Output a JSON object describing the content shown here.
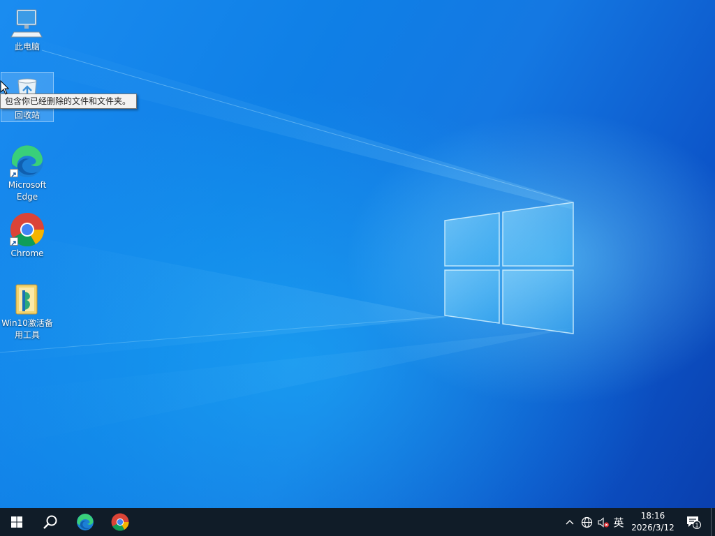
{
  "desktop": {
    "icons": [
      {
        "name": "this-pc",
        "label": "此电脑",
        "icon": "computer-icon"
      },
      {
        "name": "recycle-bin",
        "label": "回收站",
        "icon": "recycle-bin-icon",
        "selected": true
      },
      {
        "name": "microsoft-edge",
        "label": "Microsoft Edge",
        "icon": "edge-icon",
        "shortcut": true
      },
      {
        "name": "chrome",
        "label": "Chrome",
        "icon": "chrome-icon",
        "shortcut": true
      },
      {
        "name": "win10-activation-tool",
        "label": "Win10激活备用工具",
        "icon": "folder-tool-icon"
      }
    ],
    "tooltip": "包含你已经删除的文件和文件夹。"
  },
  "taskbar": {
    "buttons": [
      {
        "name": "start-button",
        "icon": "windows-logo-icon"
      },
      {
        "name": "search-button",
        "icon": "search-icon"
      },
      {
        "name": "edge-taskbar-button",
        "icon": "edge-icon"
      },
      {
        "name": "chrome-taskbar-button",
        "icon": "chrome-icon"
      }
    ],
    "tray": {
      "chevron_icon": "chevron-up-icon",
      "network_icon": "globe-icon",
      "volume_icon": "volume-muted-icon",
      "ime_label": "英",
      "time": "18:16",
      "date": "2026/3/12",
      "notification_icon": "notification-icon",
      "notification_count": "1"
    }
  },
  "colors": {
    "taskbar": "#101c28",
    "desktop_accent": "#0f7fe6"
  }
}
